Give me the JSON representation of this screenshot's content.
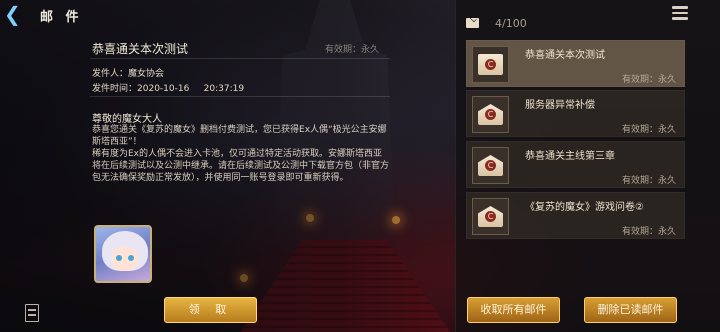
{
  "header": {
    "title": "邮 件",
    "back_icon": "back-arrow-icon"
  },
  "detail": {
    "subject": "恭喜通关本次测试",
    "validity": "有效期：永久",
    "sender_label": "发件人：",
    "sender": "魔女协会",
    "time_label": "发件时间：",
    "date": "2020-10-16",
    "time": "20:37:19",
    "greeting": "尊敬的魔女大人",
    "body": "恭喜您通关《复苏的魔女》删档付费测试，您已获得Ex人偶“极光公主安娜斯塔西亚”！\n稀有度为Ex的人偶不会进入卡池，仅可通过特定活动获取。安娜斯塔西亚将在后续测试以及公测中继承。请在后续测试及公测中下载官方包（非官方包无法确保奖励正常发放），并使用同一账号登录即可重新获得。",
    "reward_icon": "character-portrait",
    "claim_label": "领 取"
  },
  "list": {
    "count": "4/100",
    "items": [
      {
        "title": "恭喜通关本次测试",
        "validity": "有效期：永久",
        "selected": true
      },
      {
        "title": "服务器异常补偿",
        "validity": "有效期：永久",
        "selected": false
      },
      {
        "title": "恭喜通关主线第三章",
        "validity": "有效期：永久",
        "selected": false
      },
      {
        "title": "《复苏的魔女》游戏问卷②",
        "validity": "有效期：永久",
        "selected": false
      }
    ],
    "claim_all_label": "收取所有邮件",
    "delete_read_label": "删除已读邮件"
  },
  "colors": {
    "accent_gold": "#e7b543",
    "back_arrow": "#7fd0ff"
  }
}
